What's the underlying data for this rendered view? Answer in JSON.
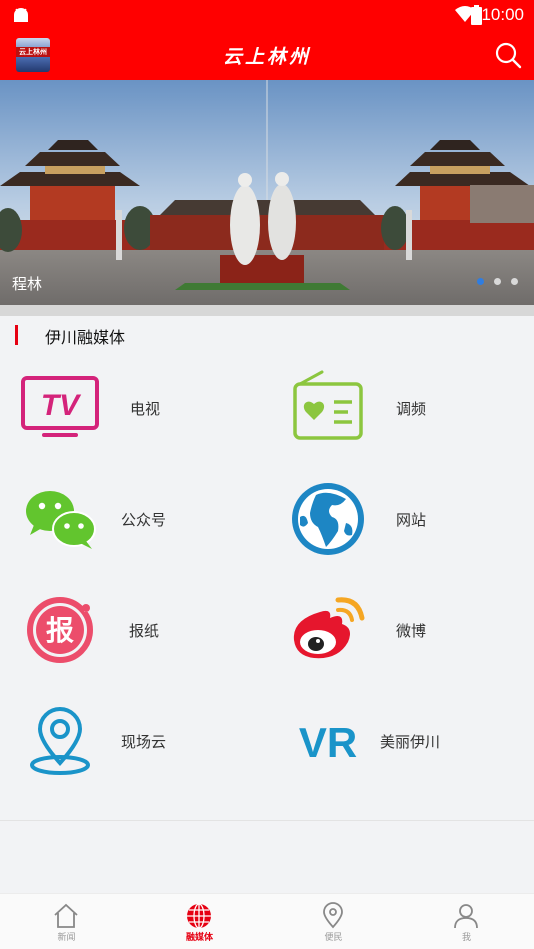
{
  "status_bar": {
    "time": "10:00"
  },
  "app_bar": {
    "logo_text": "云上林州",
    "title": "云上林州"
  },
  "banner": {
    "caption": "程林",
    "dot_count": 3,
    "active_dot": 1
  },
  "section": {
    "title": "伊川融媒体"
  },
  "tiles": [
    {
      "label": "电视",
      "icon": "tv-icon"
    },
    {
      "label": "调频",
      "icon": "radio-icon"
    },
    {
      "label": "公众号",
      "icon": "wechat-icon"
    },
    {
      "label": "网站",
      "icon": "globe-icon"
    },
    {
      "label": "报纸",
      "icon": "newspaper-icon"
    },
    {
      "label": "微博",
      "icon": "weibo-icon"
    },
    {
      "label": "现场云",
      "icon": "location-pin-icon"
    },
    {
      "label": "美丽伊川",
      "icon": "vr-icon"
    }
  ],
  "tabs": [
    {
      "label": "新闻",
      "icon": "home-icon"
    },
    {
      "label": "融媒体",
      "icon": "globe-icon",
      "active": true
    },
    {
      "label": "便民",
      "icon": "location-pin-icon"
    },
    {
      "label": "我",
      "icon": "user-icon"
    }
  ],
  "colors": {
    "brand_red": "#ff0000",
    "accent_blue": "#2f7de1",
    "tv_magenta": "#d4237a",
    "radio_green": "#8cc63f",
    "wechat_green": "#62c52e",
    "globe_blue": "#1d86c4",
    "vr_blue": "#1a94c9"
  }
}
